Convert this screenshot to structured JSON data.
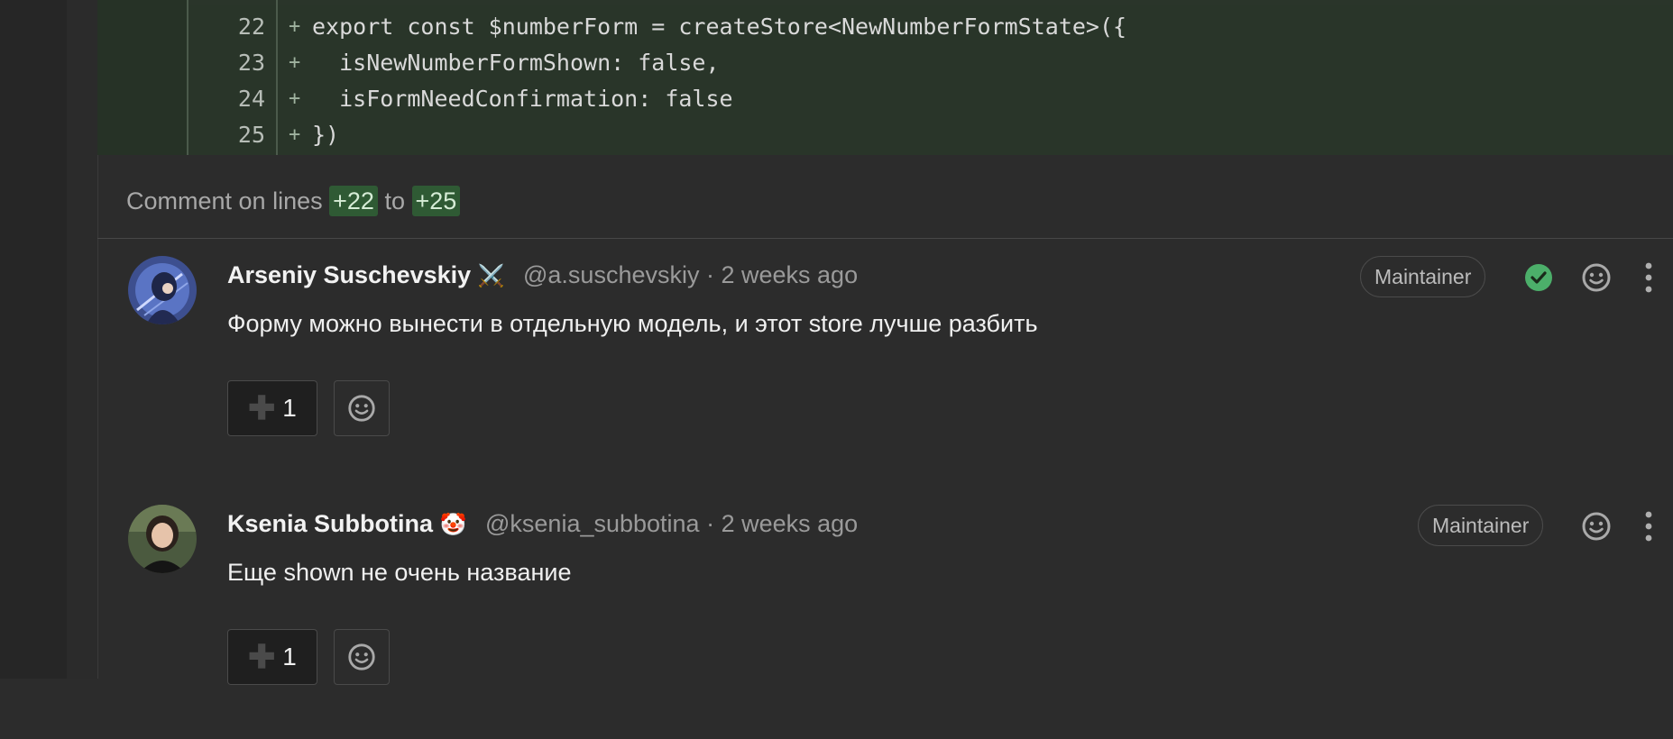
{
  "diff": {
    "lines": [
      {
        "num": "22",
        "marker": "+",
        "code": "export const $numberForm = createStore<NewNumberFormState>({"
      },
      {
        "num": "23",
        "marker": "+",
        "code": "  isNewNumberFormShown: false,"
      },
      {
        "num": "24",
        "marker": "+",
        "code": "  isFormNeedConfirmation: false"
      },
      {
        "num": "25",
        "marker": "+",
        "code": "})"
      }
    ]
  },
  "comment_header": {
    "prefix": "Comment on lines",
    "from": "+22",
    "middle": "to",
    "to": "+25"
  },
  "notes": [
    {
      "author": "Arseniy Suschevskiy",
      "author_emoji": "⚔️",
      "handle": "@a.suschevskiy",
      "time": "· 2 weeks ago",
      "badge": "Maintainer",
      "body": "Форму можно вынести в отдельную модель, и этот store лучше разбить",
      "thumbs_count": "1",
      "resolved": true
    },
    {
      "author": "Ksenia Subbotina",
      "author_emoji": "🤡",
      "handle": "@ksenia_subbotina",
      "time": "· 2 weeks ago",
      "badge": "Maintainer",
      "body": "Еще shown не очень название",
      "thumbs_count": "1",
      "resolved": false
    }
  ],
  "colors": {
    "diff_bg": "#293529",
    "accent_green": "#2f5a34",
    "resolved_green": "#4caf6a"
  }
}
